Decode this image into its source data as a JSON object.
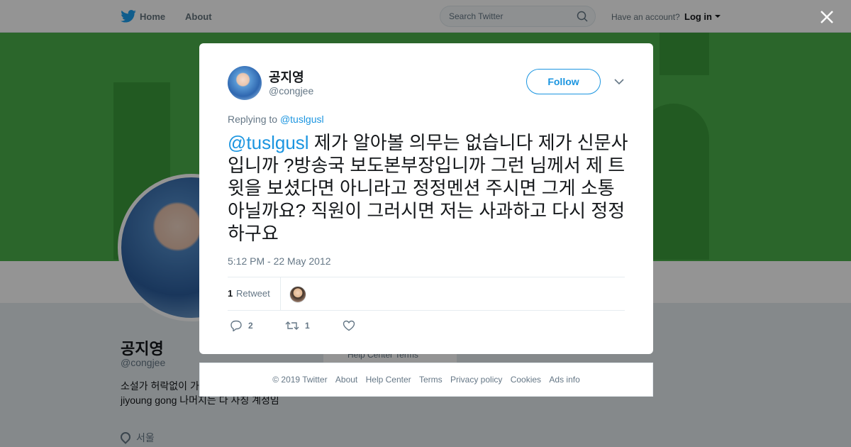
{
  "nav": {
    "home_label": "Home",
    "about_label": "About",
    "search_placeholder": "Search Twitter",
    "account_prompt": "Have an account?",
    "login_label": "Log in"
  },
  "profile": {
    "name": "공지영",
    "handle": "@congjee",
    "bio": "소설가 허락없이 가져가지 마세요. 정은 jiyoung gong 나머지는 다 사칭 계정임",
    "location": "서울",
    "background_footer": "Help Center   Terms"
  },
  "tweet": {
    "author_name": "공지영",
    "author_handle": "@congjee",
    "follow_label": "Follow",
    "replying_to_prefix": "Replying to",
    "replying_to_handle": "@tuslgusl",
    "mention": "@tuslgusl",
    "text": " 제가 알아볼 의무는 없습니다 제가 신문사입니까 ?방송국 보도본부장입니까 그런 님께서 제 트윗을 보셨다면 아니라고 정정멘션 주시면  그게 소통 아닐까요? 직원이 그러시면 저는 사과하고 다시 정정하구요",
    "timestamp": "5:12 PM - 22 May 2012",
    "retweet_count": "1",
    "retweet_label": "Retweet",
    "actions": {
      "reply_count": "2",
      "retweet_count": "1"
    }
  },
  "footer": {
    "links": [
      "© 2019 Twitter",
      "About",
      "Help Center",
      "Terms",
      "Privacy policy",
      "Cookies",
      "Ads info"
    ]
  },
  "colors": {
    "accent": "#1b95e0",
    "banner": "#4ab04a"
  },
  "icons": [
    "twitter-bird-icon",
    "search-icon",
    "close-icon",
    "chevron-down-icon",
    "reply-icon",
    "retweet-icon",
    "heart-icon",
    "location-icon"
  ]
}
